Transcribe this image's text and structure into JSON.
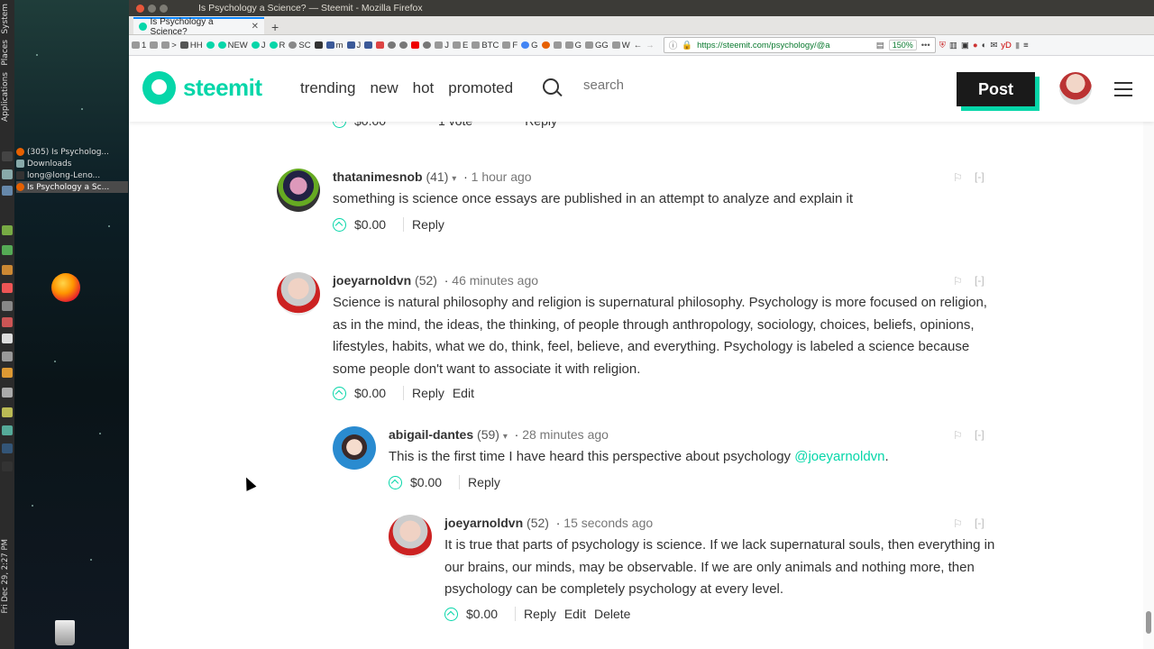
{
  "window": {
    "title": "Is Psychology a Science? — Steemit - Mozilla Firefox"
  },
  "desktop": {
    "panel_labels": [
      "System",
      "Places",
      "Applications"
    ],
    "clock": "Fri Dec 29,  2:27 PM",
    "tasks": [
      {
        "label": "(305) Is Psycholog...",
        "active": false
      },
      {
        "label": "Downloads",
        "active": false
      },
      {
        "label": "long@long-Leno...",
        "active": false
      },
      {
        "label": "Is Psychology a Sc...",
        "active": true
      }
    ]
  },
  "browser": {
    "tab_title": "Is Psychology a Science?",
    "bookmarks": [
      "1",
      ">",
      "HH",
      "NEW",
      "J",
      "R",
      "SC",
      "m",
      "J",
      "m",
      "J",
      "E",
      "BTC",
      "F",
      "G",
      "G",
      "GG",
      "W"
    ],
    "url": "https://steemit.com/psychology/@a",
    "zoom": "150%"
  },
  "steemit": {
    "logo_text": "steemit",
    "nav": [
      "trending",
      "new",
      "hot",
      "promoted"
    ],
    "search_placeholder": "search",
    "post_label": "Post"
  },
  "partial_top": {
    "payout": "$0.00",
    "votes": "1 vote",
    "reply": "Reply"
  },
  "comments": [
    {
      "author": "thatanimesnob",
      "rep": "(41)",
      "time": "1 hour ago",
      "text": "something is science once essays are published in an attempt to analyze and explain it",
      "payout": "$0.00",
      "reply": "Reply",
      "edit": "",
      "delete": "",
      "flag_collapse": "[-]"
    },
    {
      "author": "joeyarnoldvn",
      "rep": "(52)",
      "time": "46 minutes ago",
      "text": "Science is natural philosophy and religion is supernatural philosophy. Psychology is more focused on religion, as in the mind, the ideas, the thinking, of people through anthropology, sociology, choices, beliefs, opinions, lifestyles, habits, what we do, think, feel, believe, and everything. Psychology is labeled a science because some people don't want to associate it with religion.",
      "payout": "$0.00",
      "reply": "Reply",
      "edit": "Edit",
      "delete": "",
      "flag_collapse": "[-]"
    },
    {
      "author": "abigail-dantes",
      "rep": "(59)",
      "time": "28 minutes ago",
      "text": "This is the first time I have heard this perspective about psychology ",
      "mention": "@joeyarnoldvn",
      "text_end": ".",
      "payout": "$0.00",
      "reply": "Reply",
      "edit": "",
      "delete": "",
      "flag_collapse": "[-]"
    },
    {
      "author": "joeyarnoldvn",
      "rep": "(52)",
      "time": "15 seconds ago",
      "text": "It is true that parts of psychology is science. If we lack supernatural souls, then everything in our brains, our minds, may be observable. If we are only animals and nothing more, then psychology can be completely psychology at every level.",
      "payout": "$0.00",
      "reply": "Reply",
      "edit": "Edit",
      "delete": "Delete",
      "flag_collapse": "[-]"
    }
  ],
  "colors": {
    "accent": "#06d6a9",
    "dark": "#1a1a1a"
  }
}
